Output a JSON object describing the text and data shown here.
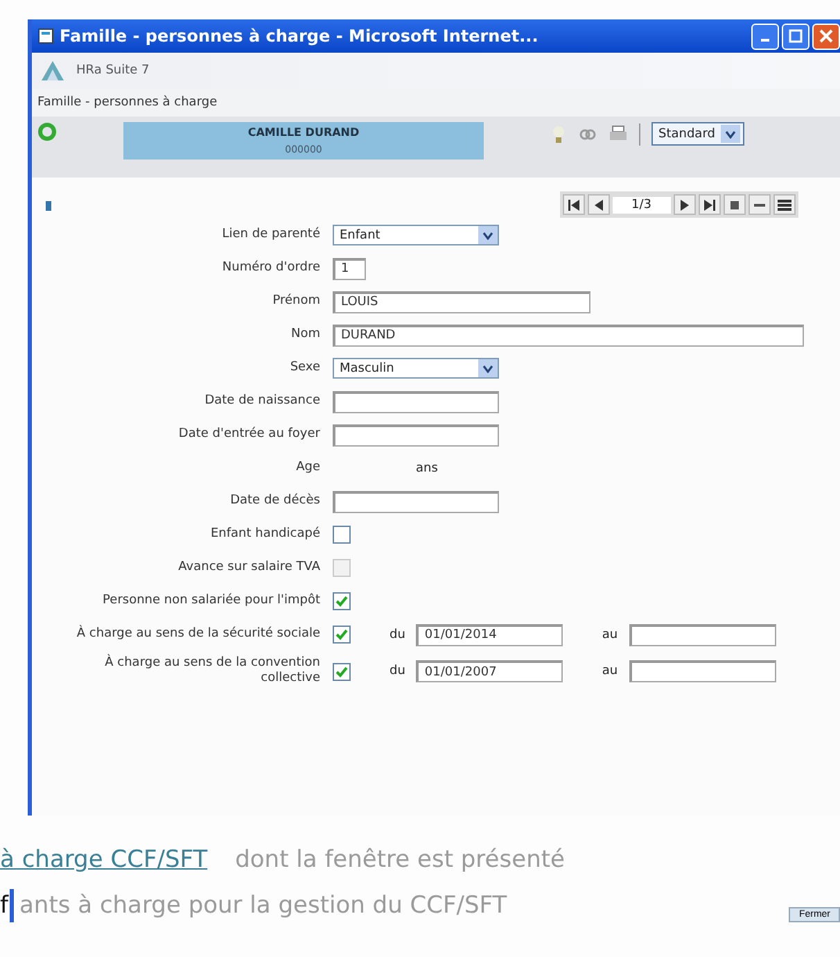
{
  "window": {
    "title": "Famille - personnes à charge - Microsoft Internet..."
  },
  "app": {
    "name": "HRa Suite 7",
    "breadcrumb": "Famille - personnes à charge"
  },
  "toolbar": {
    "employee": "CAMILLE DURAND",
    "employee_sub": "000000",
    "view": "Standard"
  },
  "pager": {
    "position": "1/3"
  },
  "fields": [
    {
      "kind": "select",
      "label": "Lien de parenté",
      "value": "Enfant"
    },
    {
      "kind": "input",
      "label": "Numéro d'ordre",
      "value": "1"
    },
    {
      "kind": "input",
      "label": "Prénom",
      "value": "LOUIS"
    },
    {
      "kind": "input",
      "label": "Nom",
      "value": "DURAND"
    },
    {
      "kind": "select",
      "label": "Sexe",
      "value": "Masculin"
    },
    {
      "kind": "input",
      "label": "Date de naissance"
    },
    {
      "kind": "input",
      "label": "Date d'entrée au foyer"
    },
    {
      "kind": "text",
      "label": "Age",
      "value": "ans"
    },
    {
      "kind": "input",
      "label": "Date de décès"
    },
    {
      "kind": "checkbox",
      "label": "Enfant handicapé",
      "checked": false,
      "disabled": false
    },
    {
      "kind": "checkbox",
      "label": "Avance sur salaire TVA",
      "checked": false,
      "disabled": true
    },
    {
      "kind": "checkbox",
      "label": "Personne non salariée pour l'impôt",
      "checked": true,
      "disabled": false
    },
    {
      "kind": "dates",
      "label": "À charge au sens de la sécurité sociale",
      "checked": true,
      "from_label": "du",
      "from": "01/01/2014",
      "to_label": "au"
    },
    {
      "kind": "dates",
      "label": "À charge au sens de la convention collective",
      "checked": true,
      "from_label": "du",
      "from": "01/01/2007",
      "to_label": "au"
    }
  ],
  "document": {
    "link": "à charge CCF/SFT",
    "ghost_1": "dont la fenêtre est présenté",
    "ghost_2_start": "f",
    "ghost_2": "ants à charge pour la gestion du CCF/SFT",
    "button": "Fermer"
  }
}
